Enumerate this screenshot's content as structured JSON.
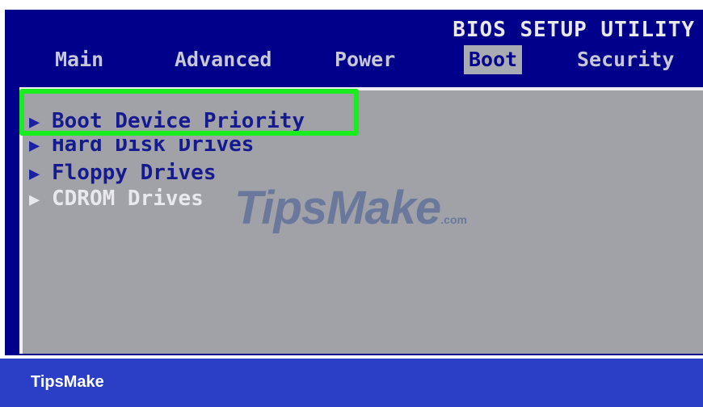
{
  "bios": {
    "title": "BIOS SETUP UTILITY",
    "menu": [
      {
        "label": "Main"
      },
      {
        "label": "Advanced"
      },
      {
        "label": "Power"
      },
      {
        "label": "Boot",
        "active": true
      },
      {
        "label": "Security"
      }
    ],
    "entries": [
      {
        "label": "Boot Device Priority"
      },
      {
        "label": "Hard Disk Drives"
      },
      {
        "label": "Floppy Drives"
      },
      {
        "label": "CDROM Drives"
      }
    ]
  },
  "watermark": {
    "text": "TipsMake",
    "suffix": ".com"
  },
  "footer": {
    "brand": "TipsMake"
  },
  "colors": {
    "bios_blue": "#00008a",
    "panel_gray": "#a1a2a8",
    "highlight_green": "#19ed1d",
    "footer_blue": "#2b3fc6"
  }
}
